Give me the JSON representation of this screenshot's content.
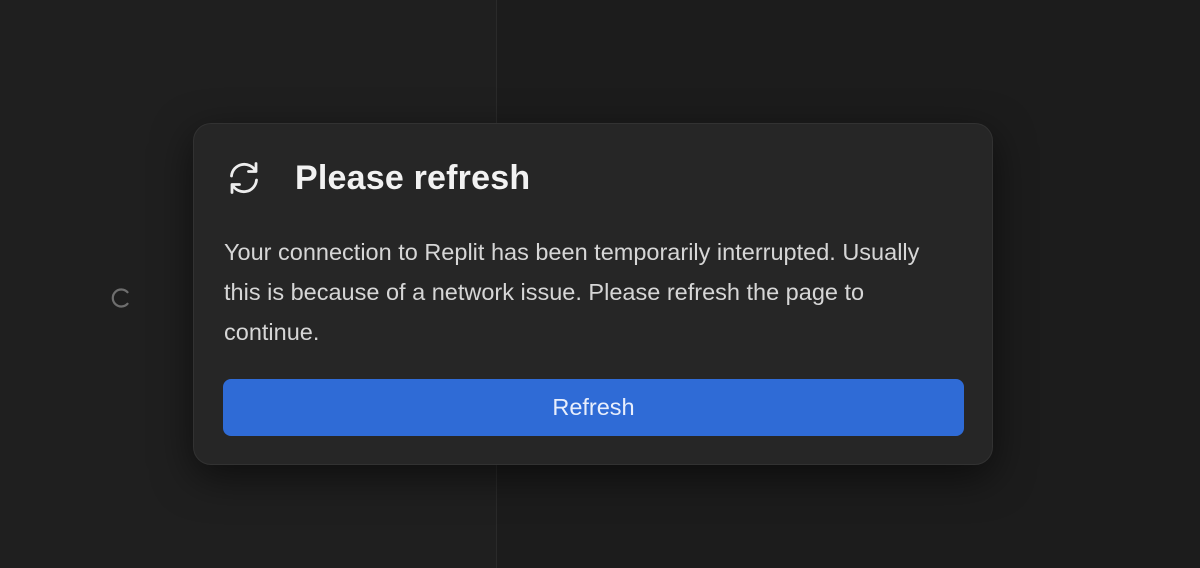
{
  "modal": {
    "title": "Please refresh",
    "message": "Your connection to Replit has been temporarily interrupted. Usually this is because of a network issue. Please refresh the page to continue.",
    "button_label": "Refresh",
    "icon": "refresh-icon"
  },
  "background": {
    "loading_indicator": "spinner-icon"
  },
  "colors": {
    "page_background": "#1c1c1c",
    "modal_background": "#262626",
    "button_background": "#2f6bd6",
    "title_text": "#f2f2f2",
    "body_text": "#d6d6d6"
  }
}
